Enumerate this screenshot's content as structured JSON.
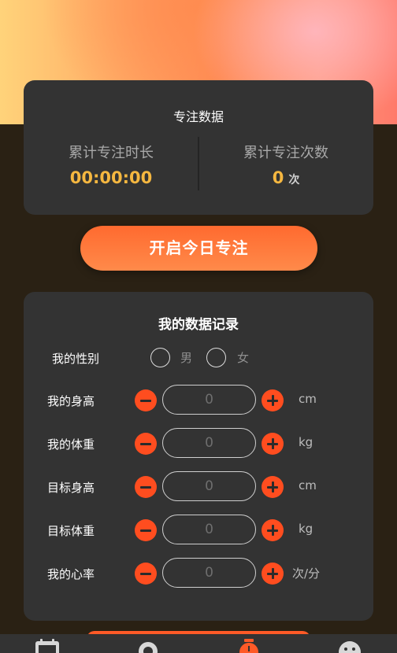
{
  "stats": {
    "title": "专注数据",
    "total_time_label": "累计专注时长",
    "total_time_value": "00:00:00",
    "total_count_label": "累计专注次数",
    "total_count_value": "0",
    "total_count_unit": "次"
  },
  "start_button_label": "开启今日专注",
  "records": {
    "title": "我的数据记录",
    "gender": {
      "label": "我的性别",
      "male": "男",
      "female": "女"
    },
    "rows": [
      {
        "label": "我的身高",
        "value": "0",
        "unit": "cm"
      },
      {
        "label": "我的体重",
        "value": "0",
        "unit": "kg"
      },
      {
        "label": "目标身高",
        "value": "0",
        "unit": "cm"
      },
      {
        "label": "目标体重",
        "value": "0",
        "unit": "kg"
      },
      {
        "label": "我的心率",
        "value": "0",
        "unit": "次/分"
      }
    ]
  },
  "tabbar": {
    "icons": [
      "calendar-icon",
      "sun-icon",
      "stopwatch-icon",
      "face-icon"
    ],
    "active_color": "#ff5a27",
    "inactive_color": "#d8d8d8"
  },
  "colors": {
    "accent": "#ff5a27",
    "value_yellow": "#f5b740"
  }
}
